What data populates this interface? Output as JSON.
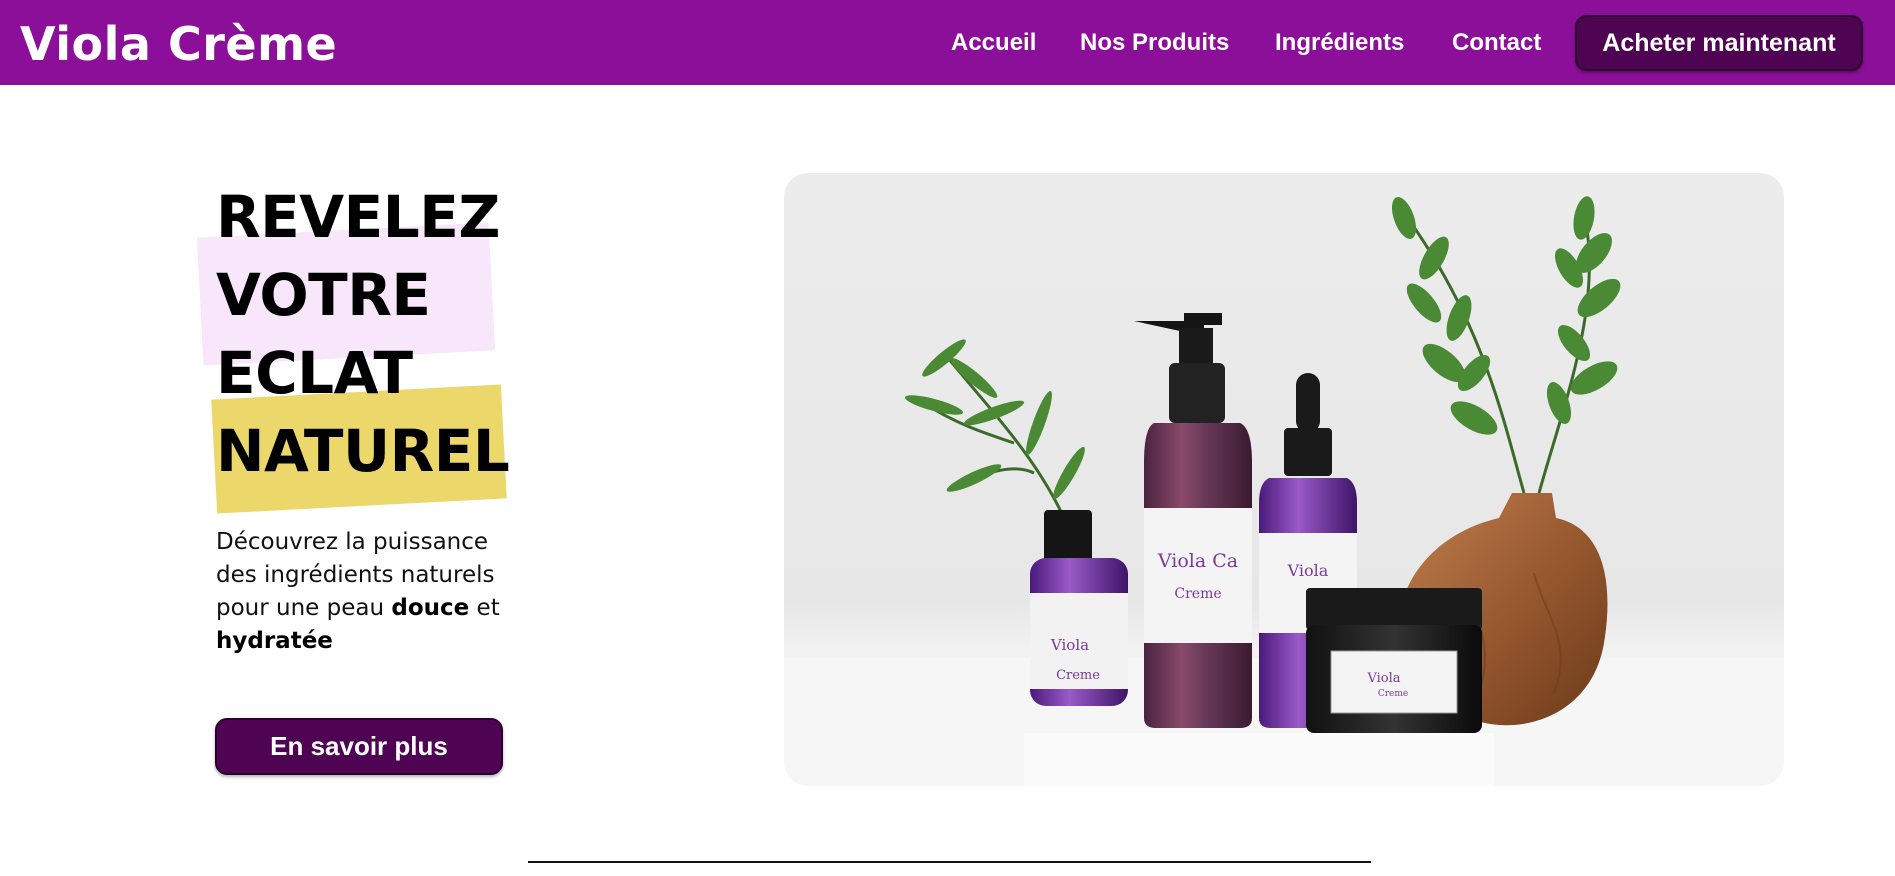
{
  "brand": {
    "name": "Viola Crème"
  },
  "nav": {
    "items": [
      "Accueil",
      "Nos Produits",
      "Ingrédients",
      "Contact"
    ],
    "cta_label": "Acheter maintenant"
  },
  "hero": {
    "headline": [
      "REVELEZ",
      "VOTRE",
      "ECLAT",
      "NATUREL"
    ],
    "subtext": {
      "part1": "Découvrez la puissance des ingrédients naturels pour une peau ",
      "bold1": "douce",
      "part2": " et ",
      "bold2": "hydratée"
    },
    "cta_label": "En savoir plus"
  },
  "product_image": {
    "labels": {
      "pump_bottle": [
        "Viola Ca",
        "Creme"
      ],
      "dropper_bottle": "Viola",
      "small_jar": [
        "Viola",
        "Creme"
      ],
      "black_jar": [
        "Viola",
        "Creme"
      ]
    }
  },
  "colors": {
    "header_bg": "#8c0f99",
    "button_bg": "#4e0452",
    "highlight_pink": "#f8e6fb",
    "highlight_yellow": "#ecd86a"
  }
}
